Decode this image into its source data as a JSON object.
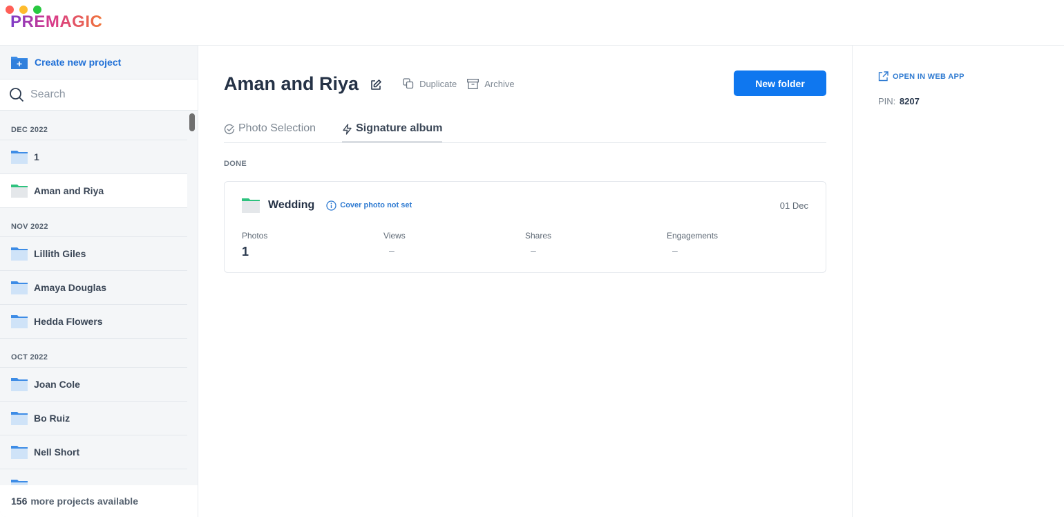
{
  "app": {
    "logo_text": "PREMAGIC"
  },
  "sidebar": {
    "create_label": "Create new project",
    "search_placeholder": "Search",
    "groups": [
      {
        "label": "DEC 2022",
        "items": [
          {
            "name": "1",
            "active": false
          },
          {
            "name": "Aman and Riya",
            "active": true
          }
        ]
      },
      {
        "label": "NOV 2022",
        "items": [
          {
            "name": "Lillith Giles"
          },
          {
            "name": "Amaya Douglas"
          },
          {
            "name": "Hedda Flowers"
          }
        ]
      },
      {
        "label": "OCT 2022",
        "items": [
          {
            "name": "Joan Cole"
          },
          {
            "name": "Bo Ruiz"
          },
          {
            "name": "Nell Short"
          }
        ]
      }
    ],
    "footer": {
      "count": "156",
      "text": "more projects available"
    }
  },
  "project": {
    "title": "Aman and Riya",
    "actions": {
      "duplicate": "Duplicate",
      "archive": "Archive"
    },
    "new_folder_label": "New folder",
    "tabs": [
      {
        "label": "Photo Selection",
        "active": false
      },
      {
        "label": "Signature album",
        "active": true
      }
    ],
    "section_label": "DONE",
    "folder_card": {
      "title": "Wedding",
      "cover_warning": "Cover photo not set",
      "date": "01 Dec",
      "stats": [
        {
          "label": "Photos",
          "value": "1"
        },
        {
          "label": "Views",
          "value": "–"
        },
        {
          "label": "Shares",
          "value": "–"
        },
        {
          "label": "Engagements",
          "value": "–"
        }
      ]
    }
  },
  "right_panel": {
    "open_web_app": "OPEN IN WEB APP",
    "pin_label": "PIN:",
    "pin_value": "8207"
  },
  "colors": {
    "accent": "#0f77ef",
    "link": "#2e7ad1",
    "folder_blue": "#3d8ce6",
    "folder_green": "#2ec27e"
  }
}
